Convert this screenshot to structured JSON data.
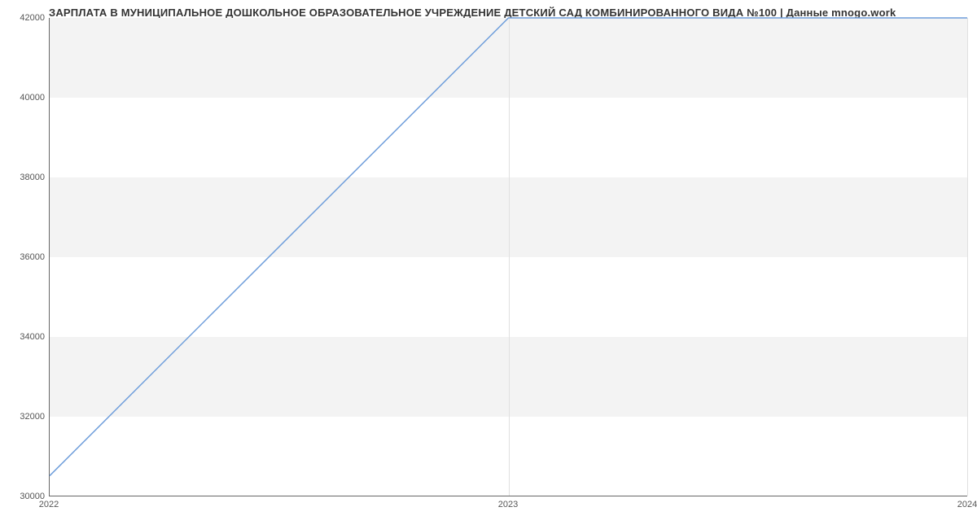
{
  "chart_data": {
    "type": "line",
    "title": "ЗАРПЛАТА В МУНИЦИПАЛЬНОЕ ДОШКОЛЬНОЕ ОБРАЗОВАТЕЛЬНОЕ УЧРЕЖДЕНИЕ ДЕТСКИЙ САД КОМБИНИРОВАННОГО ВИДА №100 | Данные mnogo.work",
    "x": [
      2022,
      2023,
      2024
    ],
    "values": [
      30500,
      42000,
      42000
    ],
    "xlabel": "",
    "ylabel": "",
    "xlim": [
      2022,
      2024
    ],
    "ylim": [
      30000,
      42000
    ],
    "y_ticks": [
      30000,
      32000,
      34000,
      36000,
      38000,
      40000,
      42000
    ],
    "x_ticks": [
      2022,
      2023,
      2024
    ],
    "line_color": "#6f9edb",
    "grid_band_color": "#f3f3f3"
  }
}
